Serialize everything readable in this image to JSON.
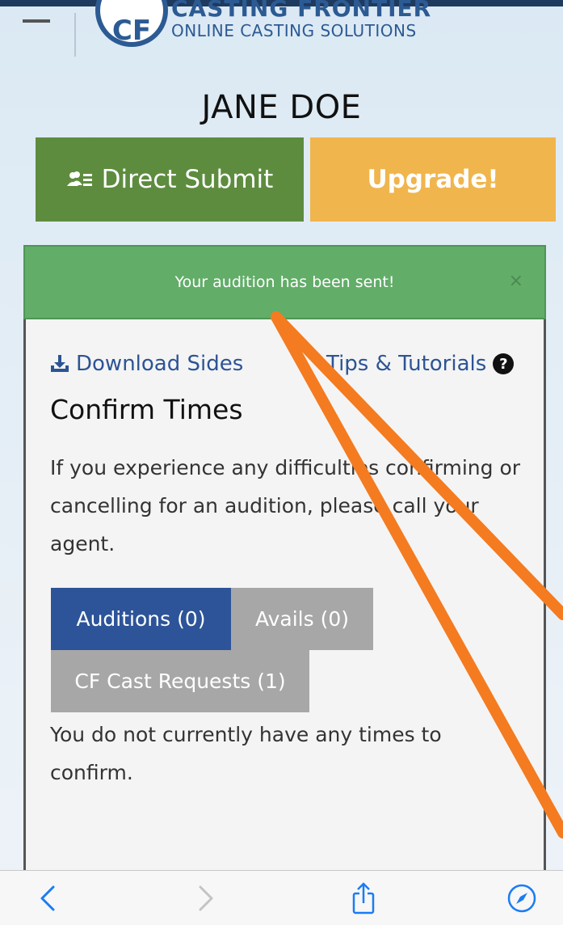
{
  "header": {
    "logo_letters": "CF",
    "logo_title": "CASTING FRONTIER",
    "logo_subtitle": "ONLINE CASTING SOLUTIONS"
  },
  "profile": {
    "name": "JANE DOE"
  },
  "actions": {
    "direct_submit_label": "Direct Submit",
    "upgrade_label": "Upgrade!"
  },
  "alert": {
    "message": "Your audition has been sent!",
    "close_label": "×",
    "color": "#62ad68"
  },
  "card": {
    "download_label": "Download Sides",
    "tips_label": "Tips & Tutorials",
    "tips_icon": "?",
    "heading": "Confirm Times",
    "info_text": "If you experience any difficulties confirming or cancelling for an audition, please call your agent.",
    "tabs": [
      {
        "label": "Auditions (0)",
        "active": true
      },
      {
        "label": "Avails (0)",
        "active": false
      },
      {
        "label": "CF Cast Requests (1)",
        "active": false
      }
    ],
    "empty_message": "You do not currently have any times to confirm."
  },
  "annotation": {
    "color": "#f47b20"
  },
  "browser_toolbar": {
    "icons": [
      "back-icon",
      "forward-icon",
      "share-icon",
      "compass-icon"
    ],
    "accent": "#1a7cf5"
  }
}
